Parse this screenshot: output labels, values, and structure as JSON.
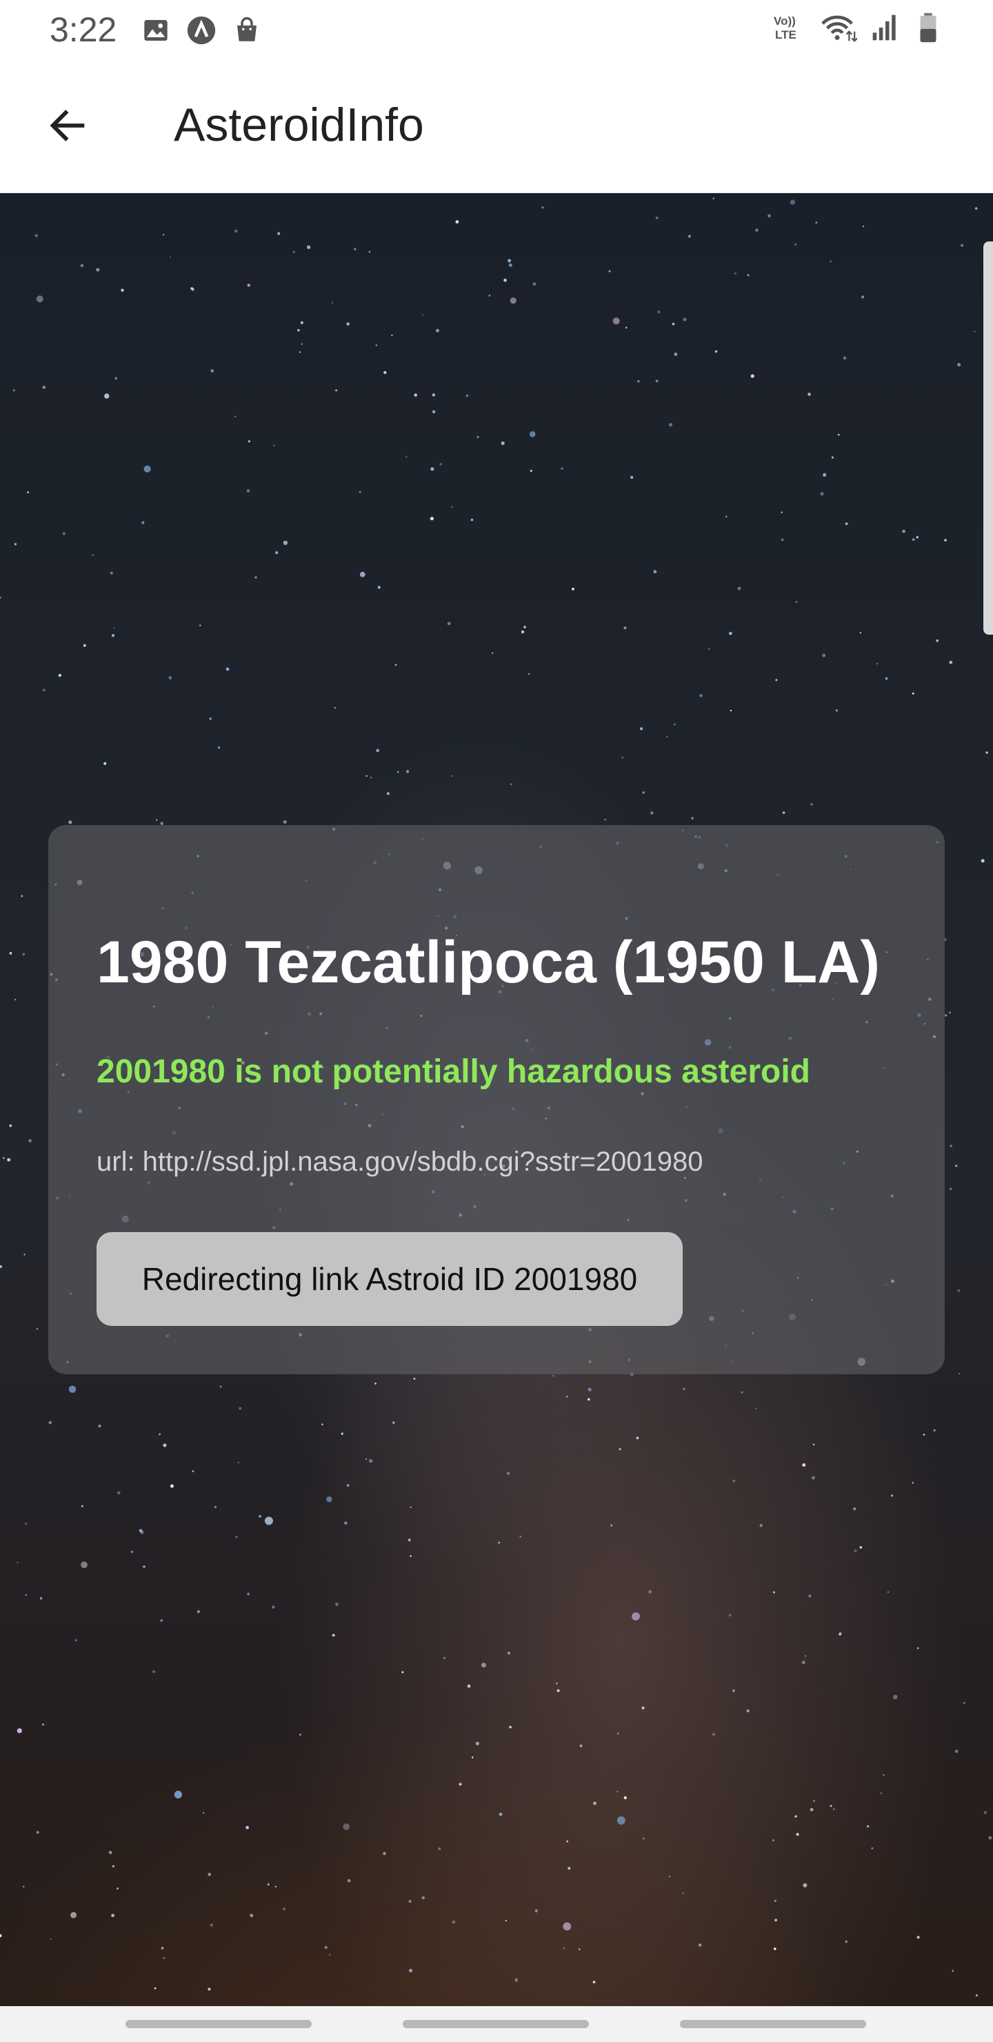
{
  "status_bar": {
    "time": "3:22",
    "left_icons": [
      "image-icon",
      "app-a-icon",
      "shopping-bag-icon"
    ],
    "right_icons": [
      "volte-icon",
      "wifi-icon",
      "signal-icon",
      "battery-icon"
    ],
    "volte_label": "VoLTE"
  },
  "app_bar": {
    "title": "AsteroidInfo",
    "back_icon": "arrow-left-icon"
  },
  "card": {
    "name": "1980 Tezcatlipoca (1950 LA)",
    "hazard_text": "2001980 is not potentially hazardous asteroid",
    "url_text": "url: http://ssd.jpl.nasa.gov/sbdb.cgi?sstr=2001980",
    "button_label": "Redirecting link Astroid ID 2001980"
  },
  "colors": {
    "hazard_safe": "#8ee85a",
    "card_bg": "#5f5f64",
    "button_bg": "#c3c3c3"
  }
}
